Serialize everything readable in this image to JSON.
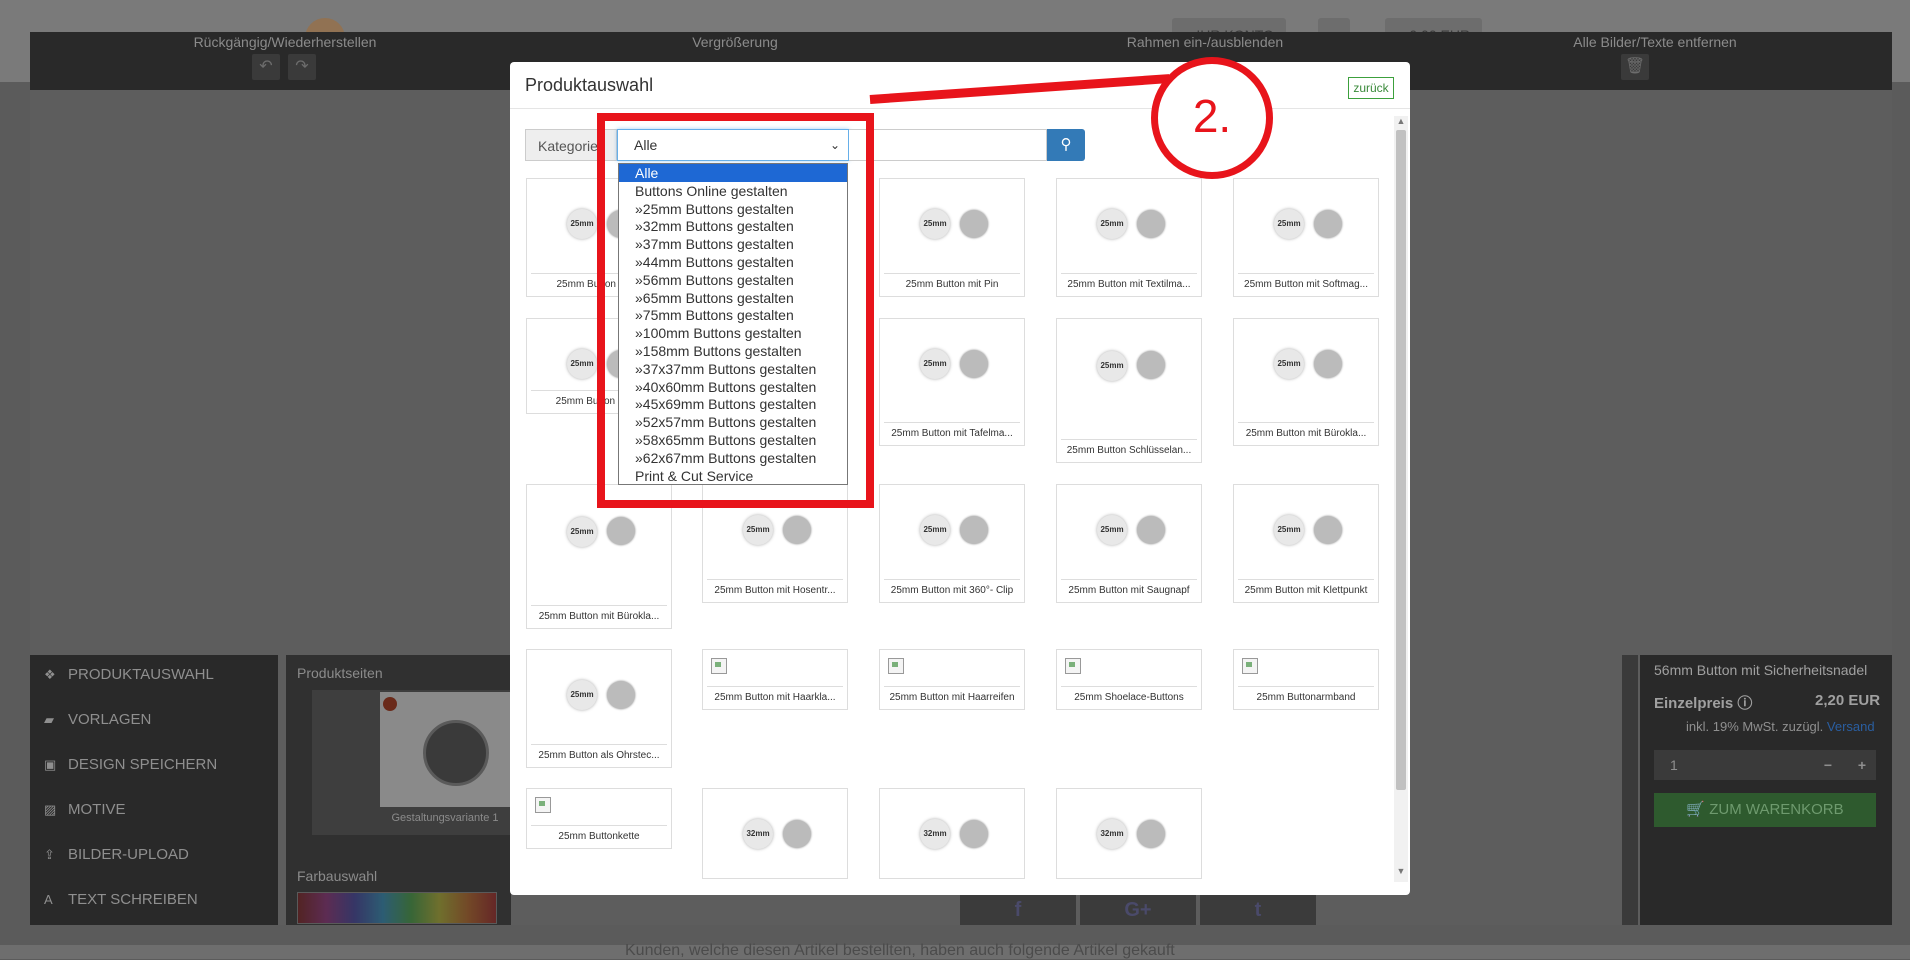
{
  "site": {
    "nav_account": "IHR KONTO",
    "nav_cart": "0,00 EUR",
    "bottom_text": "Kunden, welche diesen Artikel bestellten, haben auch folgende Artikel gekauft"
  },
  "topbar": {
    "undo_redo_label": "Rückgängig/Wiederherstellen",
    "zoom_label": "Vergrößerung",
    "frame_label": "Rahmen ein-/ausblenden",
    "remove_label": "Alle Bilder/Texte entfernen"
  },
  "left_menu": [
    {
      "label": "PRODUKTAUSWAHL",
      "icon": "cubes-icon"
    },
    {
      "label": "VORLAGEN",
      "icon": "folder-icon"
    },
    {
      "label": "DESIGN SPEICHERN",
      "icon": "floppy-icon"
    },
    {
      "label": "MOTIVE",
      "icon": "image-icon"
    },
    {
      "label": "BILDER-UPLOAD",
      "icon": "upload-icon"
    },
    {
      "label": "TEXT SCHREIBEN",
      "icon": "text-icon"
    }
  ],
  "pages_panel": {
    "title": "Produktseiten",
    "thumb_caption": "Gestaltungsvariante 1",
    "color_title": "Farbauswahl"
  },
  "right_panel": {
    "product": "56mm Button mit Sicherheitsnadel",
    "price_label": "Einzelpreis",
    "price": "2,20 EUR",
    "tax": "inkl. 19% MwSt. zuzügl.",
    "shipping_link": "Versand",
    "qty": "1",
    "cart_button": "ZUM WARENKORB"
  },
  "modal": {
    "title": "Produktauswahl",
    "back_button": "zurück",
    "category_label": "Kategorien",
    "category_value": "Alle",
    "search_placeholder": ""
  },
  "dropdown_options": [
    "Alle",
    "Buttons Online gestalten",
    "»25mm Buttons gestalten",
    "»32mm Buttons gestalten",
    "»37mm Buttons gestalten",
    "»44mm Buttons gestalten",
    "»56mm Buttons gestalten",
    "»65mm Buttons gestalten",
    "»75mm Buttons gestalten",
    "»100mm Buttons gestalten",
    "»158mm Buttons gestalten",
    "»37x37mm Buttons gestalten",
    "»40x60mm Buttons gestalten",
    "»45x69mm Buttons gestalten",
    "»52x57mm Buttons gestalten",
    "»58x65mm Buttons gestalten",
    "»62x67mm Buttons gestalten",
    "Print & Cut Service"
  ],
  "products": [
    {
      "caption": "25mm Button mit B",
      "badge": "25mm"
    },
    {
      "caption": "",
      "badge": ""
    },
    {
      "caption": "25mm Button mit Pin",
      "badge": "25mm"
    },
    {
      "caption": "25mm Button mit Textilma...",
      "badge": "25mm"
    },
    {
      "caption": "25mm Button mit Softmag...",
      "badge": "25mm"
    },
    {
      "caption": "25mm Button mit M",
      "badge": "25mm"
    },
    {
      "caption": "",
      "badge": ""
    },
    {
      "caption": "25mm Button mit Tafelma...",
      "badge": "25mm"
    },
    {
      "caption": "25mm Button Schlüsselan...",
      "badge": "25mm"
    },
    {
      "caption": "25mm Button mit Bürokla...",
      "badge": "25mm"
    },
    {
      "caption": "25mm Button mit Bürokla...",
      "badge": "25mm"
    },
    {
      "caption": "25mm Button mit Hosentr...",
      "badge": "25mm"
    },
    {
      "caption": "25mm Button mit 360°- Clip",
      "badge": "25mm"
    },
    {
      "caption": "25mm Button mit Saugnapf",
      "badge": "25mm"
    },
    {
      "caption": "25mm Button mit Klettpunkt",
      "badge": "25mm"
    },
    {
      "caption": "25mm Button als Ohrstec...",
      "badge": "25mm"
    },
    {
      "caption": "25mm Button mit Haarkla...",
      "badge": ""
    },
    {
      "caption": "25mm Button mit Haarreifen",
      "badge": ""
    },
    {
      "caption": "25mm Shoelace-Buttons",
      "badge": ""
    },
    {
      "caption": "25mm Buttonarmband",
      "badge": ""
    },
    {
      "caption": "25mm Buttonkette",
      "badge": ""
    },
    {
      "caption": "",
      "badge": "32mm"
    },
    {
      "caption": "",
      "badge": "32mm"
    },
    {
      "caption": "",
      "badge": "32mm"
    }
  ],
  "annotation": {
    "step_number": "2.",
    "color": "#e8141b"
  },
  "colors": {
    "accent_blue": "#337ab7",
    "select_highlight": "#1e68d4",
    "cart_green": "#2e5a2e"
  }
}
